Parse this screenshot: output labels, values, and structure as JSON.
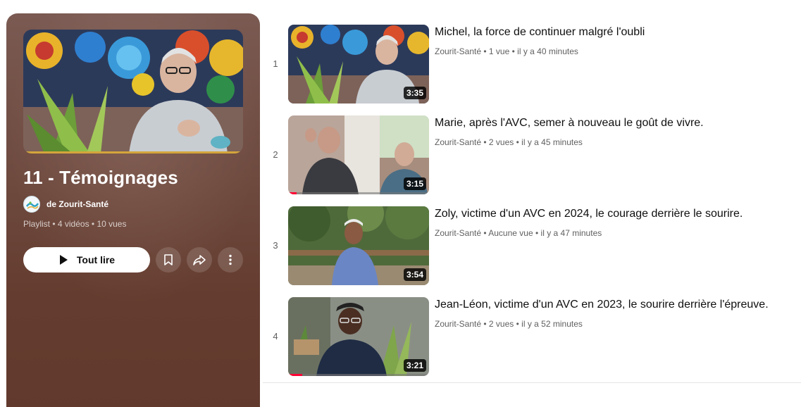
{
  "playlist": {
    "title": "11 - Témoignages",
    "owner": "de Zourit-Santé",
    "meta": "Playlist • 4 vidéos • 10 vues",
    "play_all_label": "Tout lire",
    "colors": {
      "panel_top": "#7a5a52",
      "panel_bottom": "#613a2d",
      "progress": "#d4a53b"
    }
  },
  "videos": [
    {
      "index": "1",
      "title": "Michel, la force de continuer malgré l'oubli",
      "channel": "Zourit-Santé",
      "views": "1 vue",
      "age": "il y a 40 minutes",
      "duration": "3:35",
      "watched_fraction": 0.0
    },
    {
      "index": "2",
      "title": "Marie, après l'AVC, semer à nouveau le goût de vivre.",
      "channel": "Zourit-Santé",
      "views": "2 vues",
      "age": "il y a 45 minutes",
      "duration": "3:15",
      "watched_fraction": 0.06
    },
    {
      "index": "3",
      "title": "Zoly, victime d'un AVC en 2024, le courage derrière le sourire.",
      "channel": "Zourit-Santé",
      "views": "Aucune vue",
      "age": "il y a 47 minutes",
      "duration": "3:54",
      "watched_fraction": 0.0
    },
    {
      "index": "4",
      "title": "Jean-Léon, victime d'un AVC en 2023, le sourire derrière l'épreuve.",
      "channel": "Zourit-Santé",
      "views": "2 vues",
      "age": "il y a 52 minutes",
      "duration": "3:21",
      "watched_fraction": 0.1
    }
  ],
  "separator": "•",
  "icons": {
    "play": "play-icon",
    "save": "bookmark-icon",
    "share": "share-icon",
    "more": "more-vert-icon"
  }
}
